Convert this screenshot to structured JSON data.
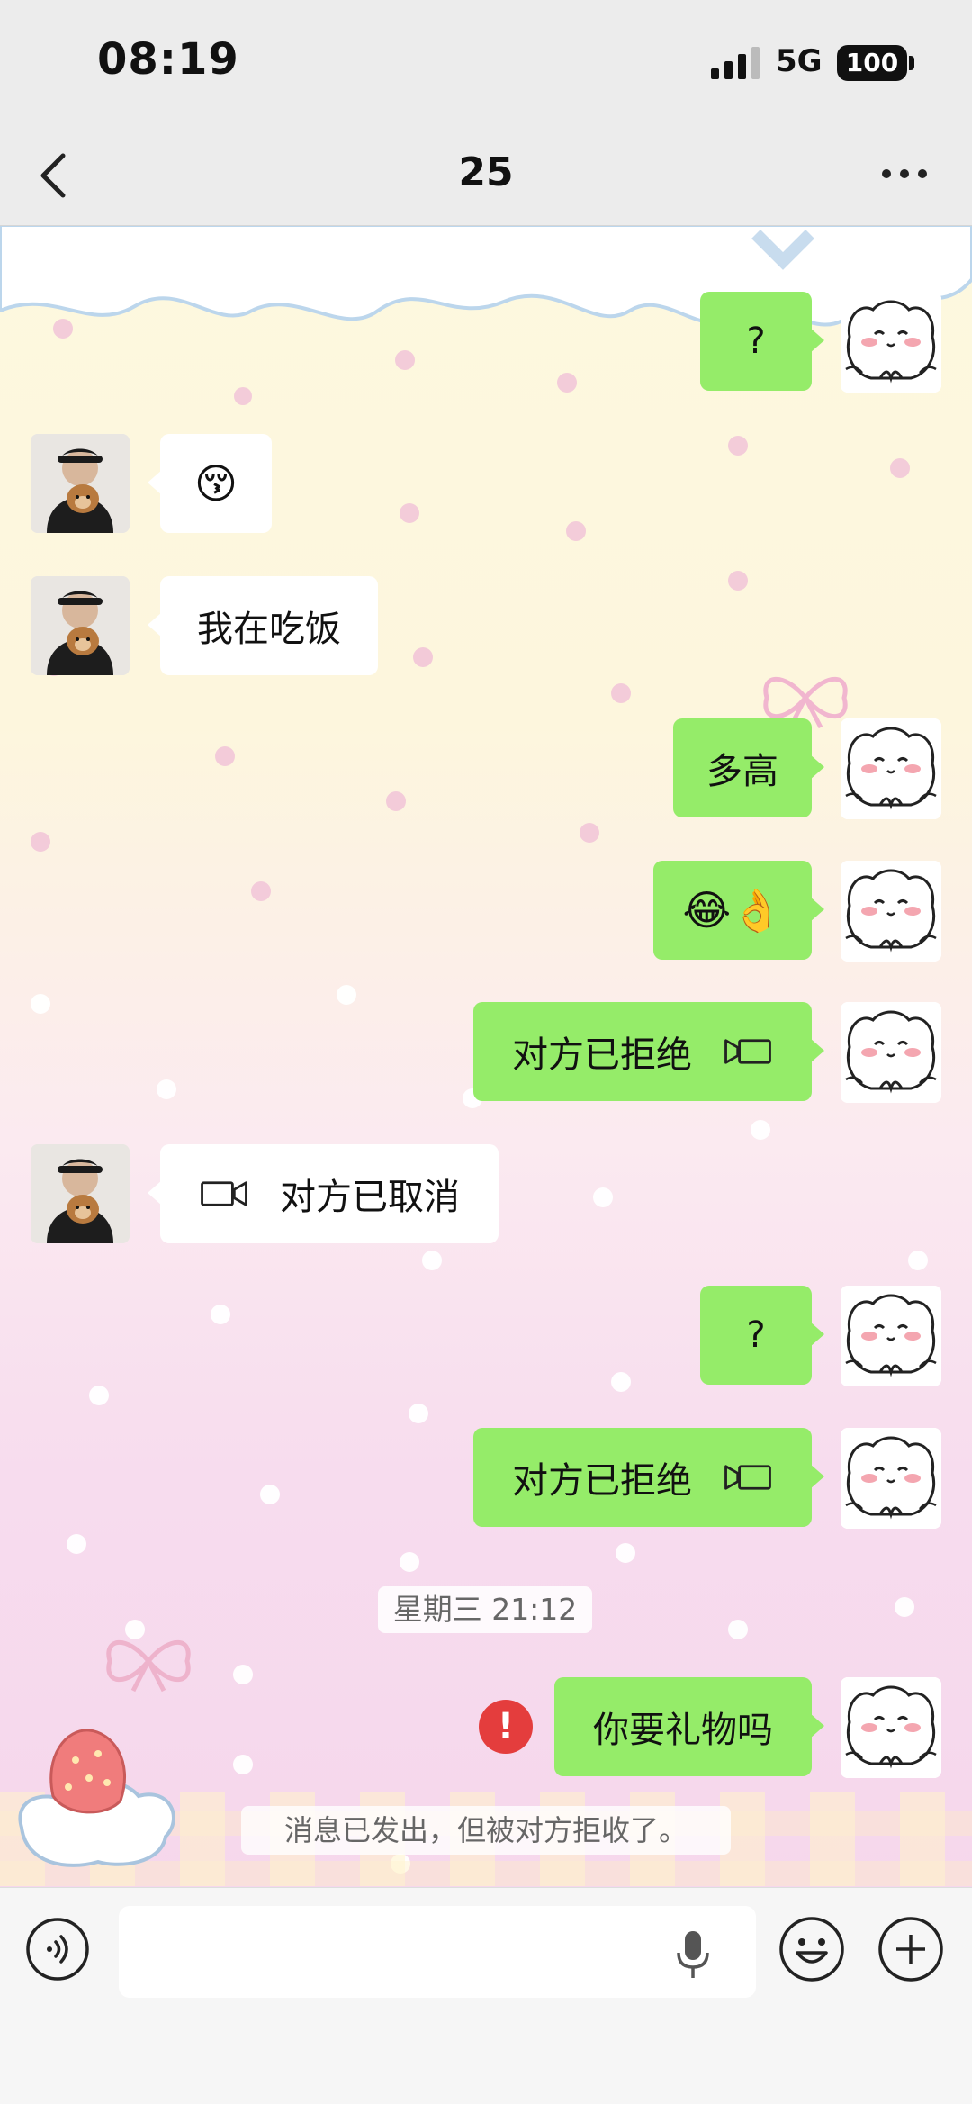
{
  "status_bar": {
    "time": "08:19",
    "network": "5G",
    "battery": "100"
  },
  "header": {
    "title": "25"
  },
  "messages": [
    {
      "side": "me",
      "kind": "text",
      "text": "?"
    },
    {
      "side": "other",
      "kind": "emoji",
      "text": "😚"
    },
    {
      "side": "other",
      "kind": "text",
      "text": "我在吃饭"
    },
    {
      "side": "me",
      "kind": "text",
      "text": "多高"
    },
    {
      "side": "me",
      "kind": "emoji",
      "text": "😂👌"
    },
    {
      "side": "me",
      "kind": "video-call",
      "text": "对方已拒绝"
    },
    {
      "side": "other",
      "kind": "video-call",
      "text": "对方已取消"
    },
    {
      "side": "me",
      "kind": "text",
      "text": "?"
    },
    {
      "side": "me",
      "kind": "video-call",
      "text": "对方已拒绝"
    },
    {
      "side": "me",
      "kind": "text",
      "text": "你要礼物吗",
      "failed": true
    }
  ],
  "timestamp_divider": "星期三 21:12",
  "system_note": "消息已发出，但被对方拒收了。",
  "input_bar": {
    "placeholder": ""
  },
  "colors": {
    "my_bubble": "#95ec69",
    "their_bubble": "#ffffff",
    "error": "#e43d3d",
    "header_bg": "#ececec"
  }
}
